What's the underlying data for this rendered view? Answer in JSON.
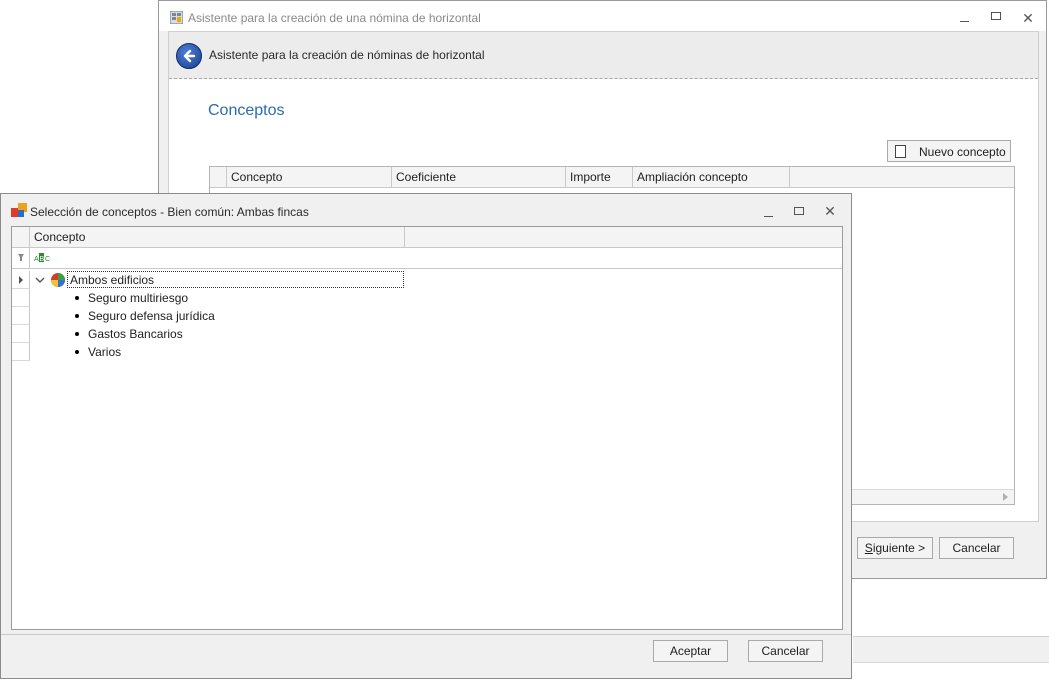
{
  "main_window": {
    "title": "Asistente para la creación de una nómina de horizontal",
    "header_title": "Asistente para la creación de nóminas de horizontal",
    "section_title": "Conceptos",
    "new_concept_button": "Nuevo concepto",
    "grid_columns": [
      "Concepto",
      "Coeficiente",
      "Importe",
      "Ampliación concepto"
    ],
    "next_button": "Siguiente >",
    "next_button_mnemonic": "S",
    "next_button_rest": "iguiente >",
    "cancel_button": "Cancelar"
  },
  "dialog": {
    "title": "Selección de conceptos - Bien común: Ambas fincas",
    "grid_column": "Concepto",
    "tree": {
      "root": "Ambos edificios",
      "children": [
        "Seguro multiriesgo",
        "Seguro defensa jurídica",
        "Gastos Bancarios",
        "Varios"
      ]
    },
    "accept_button": "Aceptar",
    "cancel_button": "Cancelar"
  },
  "icons": {
    "window_controls": [
      "minimize-icon",
      "restore-icon",
      "close-icon"
    ],
    "back": "back-arrow-icon",
    "new_doc": "document-icon",
    "filter": "filter-pin-icon",
    "abc": "abc-filter-icon",
    "root_node": "pie-chart-icon"
  },
  "colors": {
    "accent_title": "#2a6cab",
    "back_button": "#1f4ea8"
  }
}
